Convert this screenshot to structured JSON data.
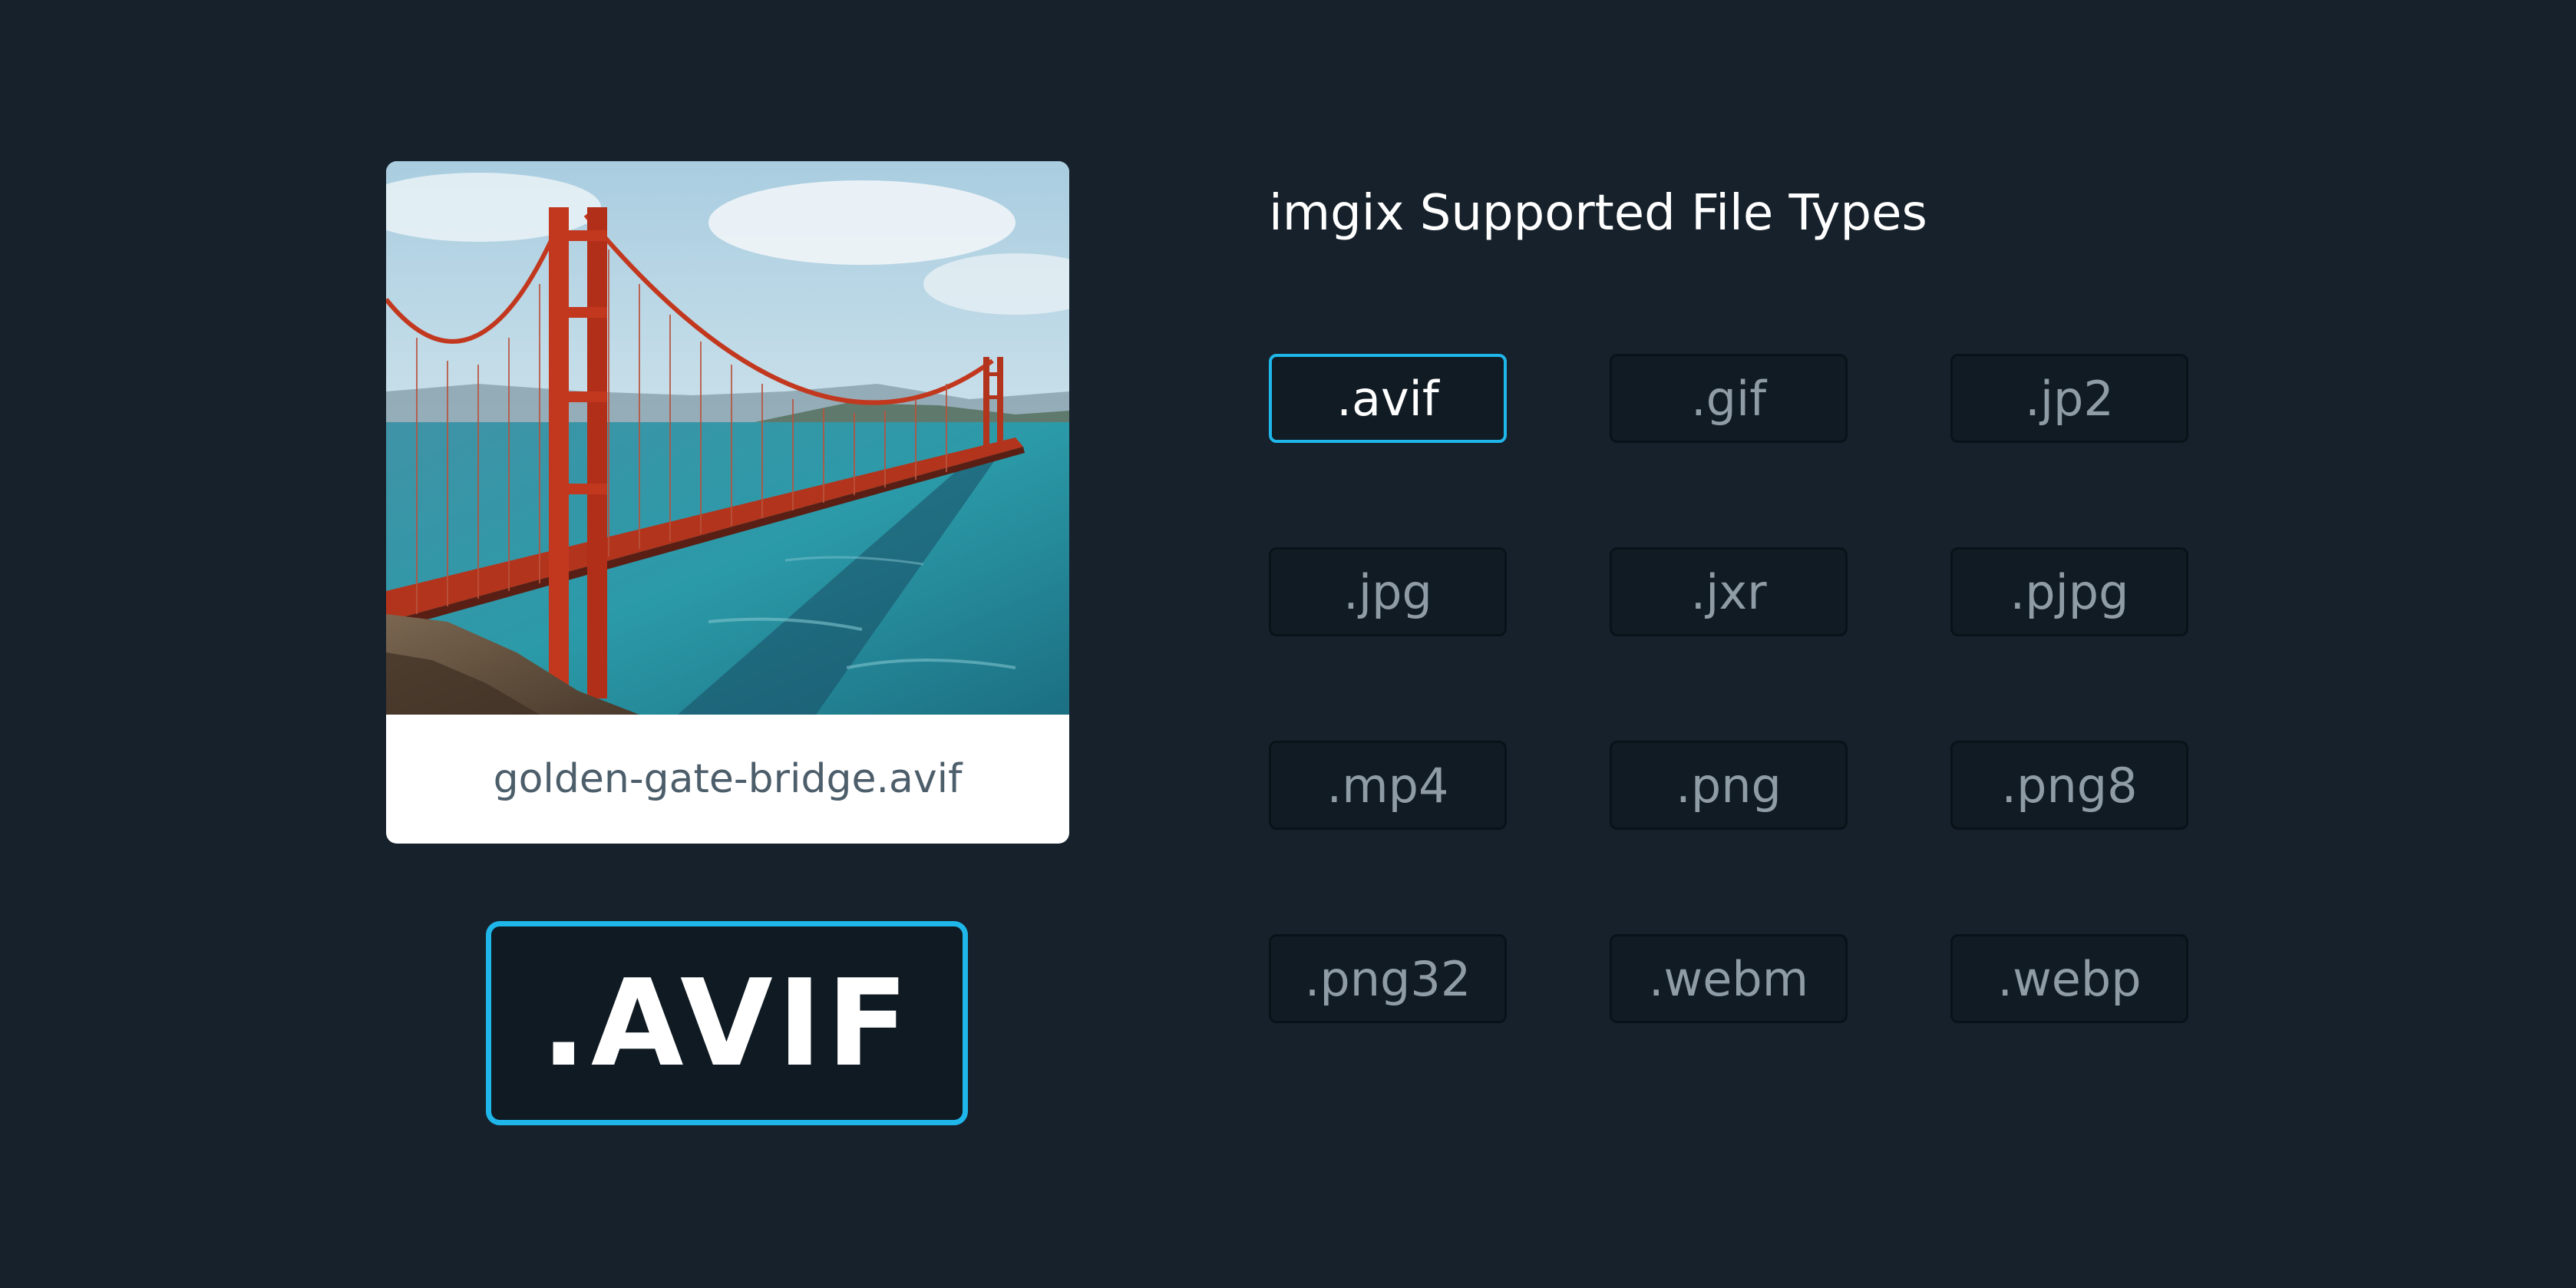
{
  "preview": {
    "filename": "golden-gate-bridge.avif",
    "photo_subject": "Golden Gate Bridge over blue water"
  },
  "format_badge": {
    "label": ".AVIF"
  },
  "heading": "imgix Supported File Types",
  "file_types": [
    {
      "label": ".avif",
      "selected": true
    },
    {
      "label": ".gif",
      "selected": false
    },
    {
      "label": ".jp2",
      "selected": false
    },
    {
      "label": ".jpg",
      "selected": false
    },
    {
      "label": ".jxr",
      "selected": false
    },
    {
      "label": ".pjpg",
      "selected": false
    },
    {
      "label": ".mp4",
      "selected": false
    },
    {
      "label": ".png",
      "selected": false
    },
    {
      "label": ".png8",
      "selected": false
    },
    {
      "label": ".png32",
      "selected": false
    },
    {
      "label": ".webm",
      "selected": false
    },
    {
      "label": ".webp",
      "selected": false
    }
  ],
  "colors": {
    "background": "#16212b",
    "accent": "#1fb6ea",
    "chip_background": "#101b23",
    "chip_text": "#8f9ca6",
    "caption_text": "#4d5e6b"
  }
}
